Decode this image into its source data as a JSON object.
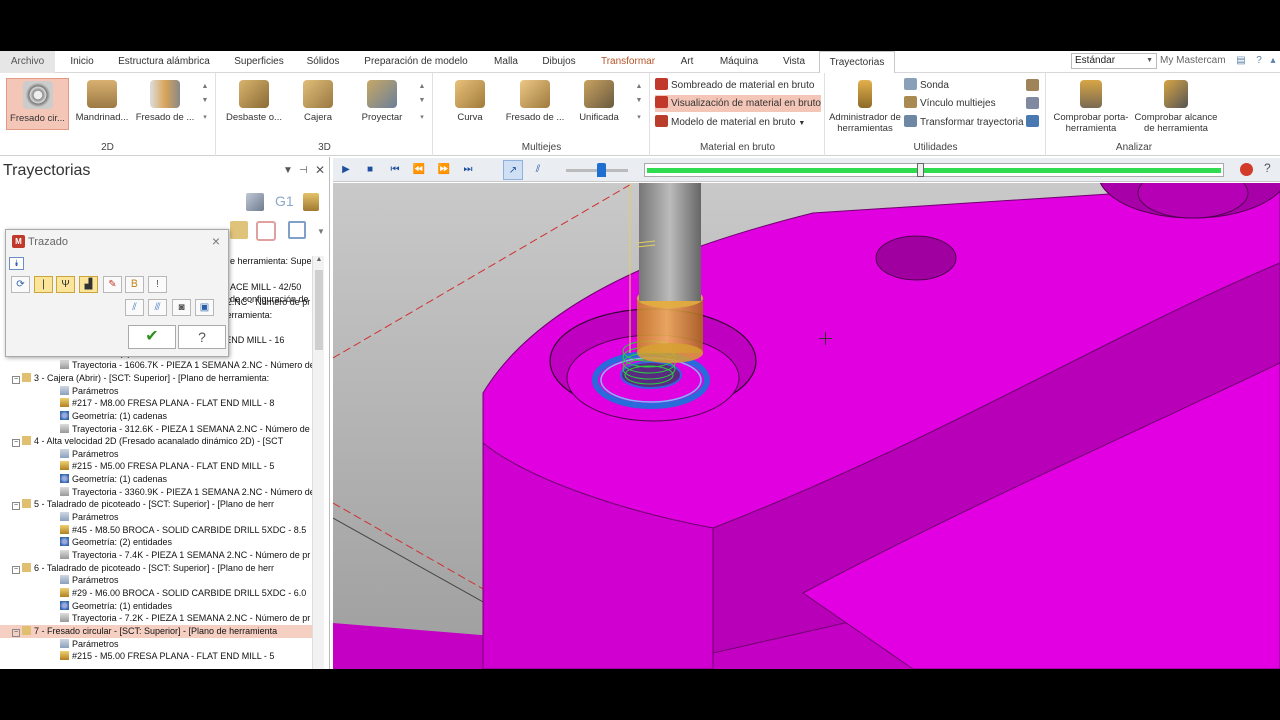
{
  "menu": {
    "tabs": [
      "Archivo",
      "Inicio",
      "Estructura alámbrica",
      "Superficies",
      "Sólidos",
      "Preparación de modelo",
      "Malla",
      "Dibujos",
      "Transformar",
      "Art",
      "Máquina",
      "Vista",
      "Trayectorias"
    ],
    "active_tab": "Trayectorias",
    "style_select": "Estándar",
    "brand": "My Mastercam"
  },
  "ribbon": {
    "groups": {
      "g2d": "2D",
      "g3d": "3D",
      "multiejes": "Multiejes",
      "material": "Material en bruto",
      "utilidades": "Utilidades",
      "analizar": "Analizar"
    },
    "b2d": [
      "Fresado cir...",
      "Mandrinad...",
      "Fresado de ..."
    ],
    "b3d": [
      "Desbaste o...",
      "Cajera",
      "Proyectar"
    ],
    "bmulti": [
      "Curva",
      "Fresado de ...",
      "Unificada"
    ],
    "material_rows": [
      "Sombreado de material en bruto",
      "Visualización de material en bruto",
      "Modelo de material en bruto"
    ],
    "util_big": "Administrador de herramientas",
    "util_rows": [
      "Sonda",
      "Vínculo multiejes",
      "Transformar trayectoria"
    ],
    "analizar": [
      "Comprobar porta-herramienta",
      "Comprobar alcance de herramienta"
    ]
  },
  "panel": {
    "title": "Trayectorias",
    "g1_label": "G1"
  },
  "dialog": {
    "title": "Trazado",
    "logo": "M",
    "ok": "✔",
    "help": "?"
  },
  "tree_partial": {
    "r0": "e herramienta: Supe",
    "r1": "ACE MILL - 42/50",
    "r2": "de configuración de"
  },
  "tree": [
    {
      "text": "Trayectoria - 9.0K - PIEZA 1 SEMANA 2.NC - Número de pr",
      "kind": "path",
      "indent": 60
    },
    {
      "text": "2 - Contorno (2D) - [SCT: Superior] - [Plano de herramienta:",
      "kind": "op",
      "indent": 34
    },
    {
      "text": "Parámetros",
      "kind": "param",
      "indent": 60
    },
    {
      "text": "#221 - M16.00 FRESA PLANA - FLAT END MILL - 16",
      "kind": "tool",
      "indent": 60
    },
    {
      "text": "Geometría: (1) cadenas",
      "kind": "geo",
      "indent": 60
    },
    {
      "text": "Trayectoria - 1606.7K - PIEZA 1 SEMANA 2.NC - Número de",
      "kind": "path",
      "indent": 60
    },
    {
      "text": "3 - Cajera (Abrir) - [SCT: Superior] - [Plano de herramienta:",
      "kind": "op",
      "indent": 34
    },
    {
      "text": "Parámetros",
      "kind": "param",
      "indent": 60
    },
    {
      "text": "#217 - M8.00 FRESA PLANA - FLAT END MILL - 8",
      "kind": "tool",
      "indent": 60
    },
    {
      "text": "Geometría: (1) cadenas",
      "kind": "geo",
      "indent": 60
    },
    {
      "text": "Trayectoria - 312.6K - PIEZA 1 SEMANA 2.NC - Número de",
      "kind": "path",
      "indent": 60
    },
    {
      "text": "4 - Alta velocidad 2D (Fresado acanalado dinámico 2D) - [SCT",
      "kind": "op",
      "indent": 34
    },
    {
      "text": "Parámetros",
      "kind": "param",
      "indent": 60
    },
    {
      "text": "#215 - M5.00 FRESA PLANA - FLAT END MILL - 5",
      "kind": "tool",
      "indent": 60
    },
    {
      "text": "Geometría: (1) cadenas",
      "kind": "geo",
      "indent": 60
    },
    {
      "text": "Trayectoria - 3360.9K - PIEZA 1 SEMANA 2.NC - Número de",
      "kind": "path",
      "indent": 60
    },
    {
      "text": "5 - Taladrado de picoteado - [SCT: Superior] - [Plano de herr",
      "kind": "op",
      "indent": 34
    },
    {
      "text": "Parámetros",
      "kind": "param",
      "indent": 60
    },
    {
      "text": "#45 - M8.50 BROCA - SOLID CARBIDE DRILL 5XDC - 8.5",
      "kind": "tool",
      "indent": 60
    },
    {
      "text": "Geometría: (2) entidades",
      "kind": "geo",
      "indent": 60
    },
    {
      "text": "Trayectoria - 7.4K - PIEZA 1 SEMANA 2.NC - Número de pr",
      "kind": "path",
      "indent": 60
    },
    {
      "text": "6 - Taladrado de picoteado - [SCT: Superior] - [Plano de herr",
      "kind": "op",
      "indent": 34
    },
    {
      "text": "Parámetros",
      "kind": "param",
      "indent": 60
    },
    {
      "text": "#29 - M6.00 BROCA - SOLID CARBIDE DRILL 5XDC - 6.0",
      "kind": "tool",
      "indent": 60
    },
    {
      "text": "Geometría: (1) entidades",
      "kind": "geo",
      "indent": 60
    },
    {
      "text": "Trayectoria - 7.2K - PIEZA 1 SEMANA 2.NC - Número de pr",
      "kind": "path",
      "indent": 60
    },
    {
      "text": "7 - Fresado circular - [SCT: Superior] - [Plano de herramienta",
      "kind": "op-hl",
      "indent": 34
    },
    {
      "text": "Parámetros",
      "kind": "param",
      "indent": 60
    },
    {
      "text": "#215 - M5.00 FRESA PLANA - FLAT END MILL - 5",
      "kind": "tool",
      "indent": 60
    }
  ],
  "playback": {
    "progress": 0.47
  },
  "colors": {
    "part": "#e600e6",
    "accent_selected": "#f4c6b8",
    "progress": "#2fdc4f"
  }
}
